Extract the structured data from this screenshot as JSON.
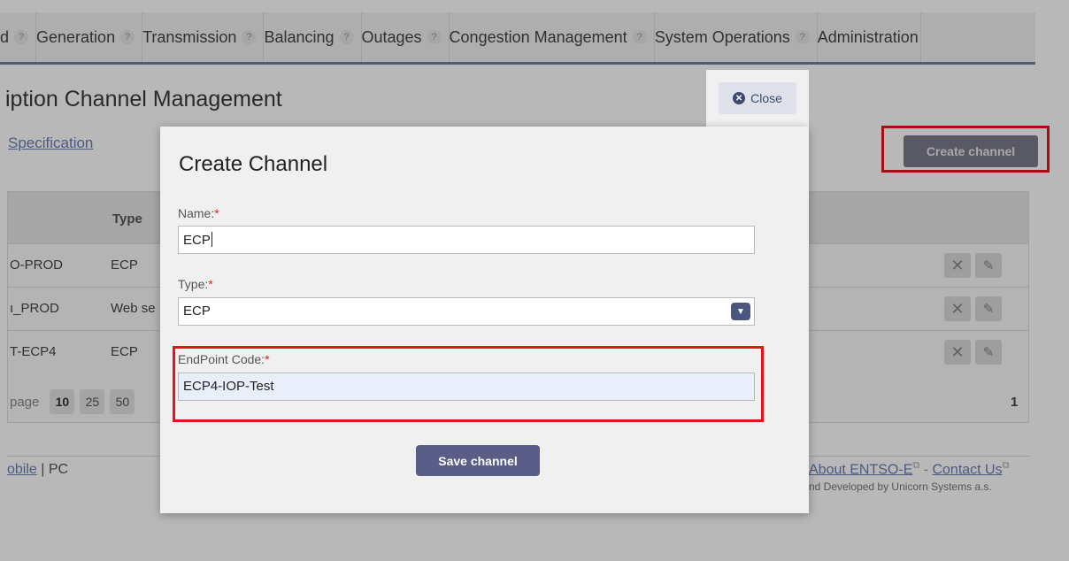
{
  "nav": {
    "items": [
      {
        "label": "d"
      },
      {
        "label": "Generation"
      },
      {
        "label": "Transmission"
      },
      {
        "label": "Balancing"
      },
      {
        "label": "Outages"
      },
      {
        "label": "Congestion Management"
      },
      {
        "label": "System Operations"
      },
      {
        "label": "Administration"
      }
    ],
    "help_glyph": "?"
  },
  "page": {
    "title": "iption Channel Management",
    "spec_link": "Specification",
    "create_button": "Create channel"
  },
  "table": {
    "header_type": "Type",
    "rows": [
      {
        "name": "O-PROD",
        "type": "ECP"
      },
      {
        "name": "ı_PROD",
        "type": "Web se"
      },
      {
        "name": "T-ECP4",
        "type": "ECP"
      }
    ],
    "pager": {
      "label": "page",
      "sizes": [
        "10",
        "25",
        "50"
      ],
      "selected": "10",
      "current_page": "1"
    }
  },
  "footer": {
    "left_link": "obile",
    "left_text": "| PC",
    "about_link": "About ENTSO-E",
    "separator": "-",
    "contact_link": "Contact Us",
    "credit": "nd Developed by Unicorn Systems a.s."
  },
  "modal": {
    "close_label": "Close",
    "title": "Create Channel",
    "name_label": "Name:",
    "name_value": "ECP",
    "type_label": "Type:",
    "type_value": "ECP",
    "endpoint_label": "EndPoint Code:",
    "endpoint_value": "ECP4-IOP-Test",
    "required_mark": "*",
    "save_label": "Save channel"
  },
  "colors": {
    "highlight": "#e8121b",
    "primary": "#5a5d86",
    "link": "#6b7db3"
  }
}
